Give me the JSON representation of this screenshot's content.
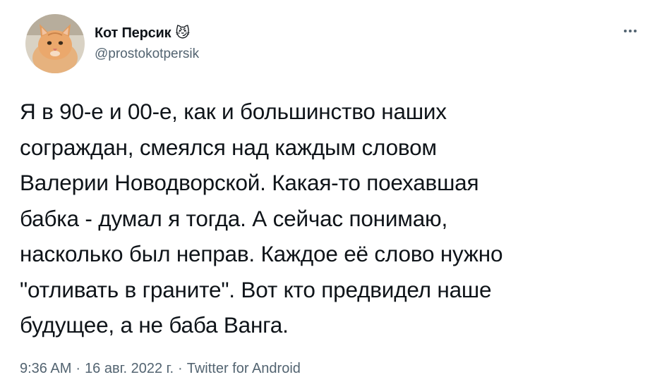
{
  "author": {
    "display_name": "Кот Персик",
    "emoji": "😼",
    "handle": "@prostokotpersik",
    "avatar_icon": "orange-cat-avatar"
  },
  "more_icon": "more-horizontal-icon",
  "tweet": {
    "text": "Я в 90-е и 00-е, как и большинство наших\nсограждан, смеялся над каждым словом\nВалерии Новодворской. Какая-то поехавшая\nбабка - думал я тогда. А сейчас понимаю,\nнасколько был неправ. Каждое её слово нужно\n\"отливать в граните\". Вот кто предвидел наше\nбудущее, а не баба Ванга."
  },
  "meta": {
    "time": "9:36 AM",
    "separator": "·",
    "date": "16 авг. 2022 г.",
    "source": "Twitter for Android"
  },
  "colors": {
    "text": "#0f1419",
    "secondary": "#536471",
    "avatar_fur": "#e8a56a"
  }
}
